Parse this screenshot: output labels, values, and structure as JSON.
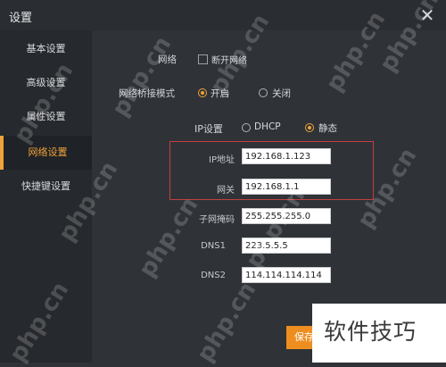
{
  "window": {
    "title": "设置"
  },
  "sidebar": {
    "items": [
      {
        "label": "基本设置"
      },
      {
        "label": "高级设置"
      },
      {
        "label": "属性设置"
      },
      {
        "label": "网络设置",
        "active": true
      },
      {
        "label": "快捷键设置"
      }
    ]
  },
  "network": {
    "label": "网络",
    "disconnect_label": "断开网络",
    "disconnect_checked": false
  },
  "bridge_mode": {
    "label": "网络桥接模式",
    "options": [
      {
        "label": "开启",
        "selected": true
      },
      {
        "label": "关闭",
        "selected": false
      }
    ]
  },
  "ip_setting": {
    "label": "IP设置",
    "options": [
      {
        "label": "DHCP",
        "selected": false
      },
      {
        "label": "静态",
        "selected": true
      }
    ]
  },
  "fields": [
    {
      "label": "IP地址",
      "value": "192.168.1.123"
    },
    {
      "label": "网关",
      "value": "192.168.1.1"
    },
    {
      "label": "子网掩码",
      "value": "255.255.255.0"
    },
    {
      "label": "DNS1",
      "value": "223.5.5.5"
    },
    {
      "label": "DNS2",
      "value": "114.114.114.114"
    }
  ],
  "apply_button": {
    "label": "保存"
  },
  "overlay": {
    "text": "软件技巧"
  },
  "watermark": "php.cn",
  "colors": {
    "accent": "#f0a23a",
    "highlight_border": "#c2403e",
    "button": "#ee8e21"
  }
}
